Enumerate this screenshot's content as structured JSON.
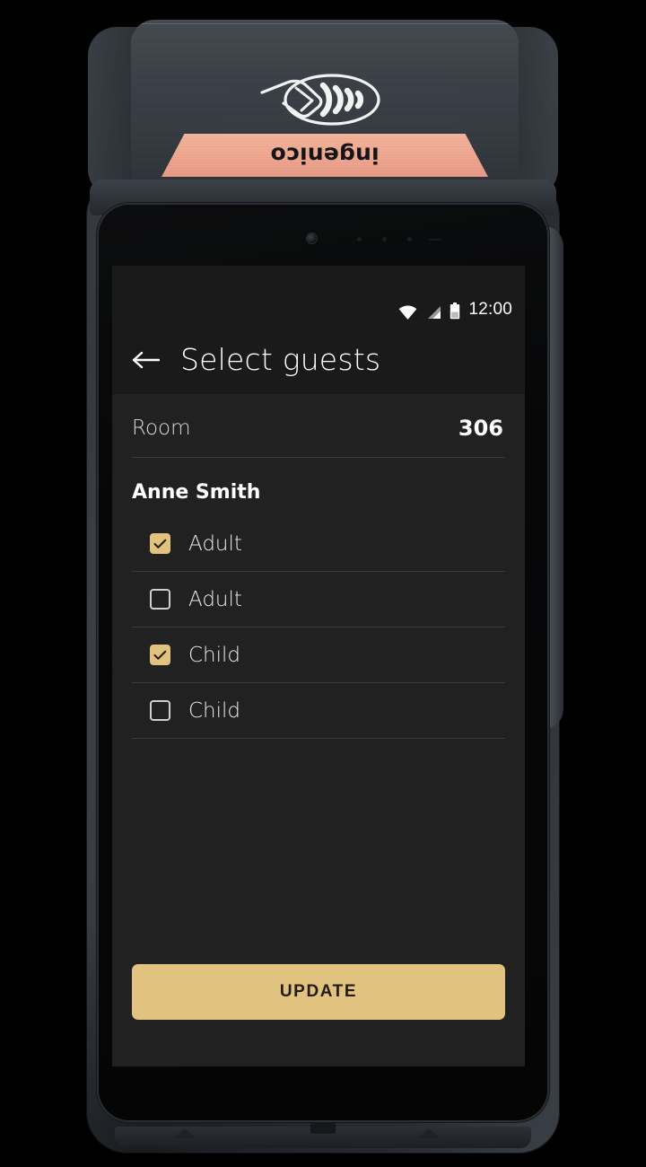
{
  "device": {
    "brand": "ingenico",
    "contactless_icon": "contactless-payment-icon"
  },
  "statusbar": {
    "wifi_icon": "wifi-icon",
    "signal_icon": "cellular-signal-icon",
    "battery_icon": "battery-icon",
    "time": "12:00"
  },
  "toolbar": {
    "back_icon": "arrow-left-icon",
    "title": "Select guests"
  },
  "room": {
    "label": "Room",
    "value": "306"
  },
  "guest": {
    "name": "Anne Smith"
  },
  "guests": [
    {
      "label": "Adult",
      "checked": true
    },
    {
      "label": "Adult",
      "checked": false
    },
    {
      "label": "Child",
      "checked": true
    },
    {
      "label": "Child",
      "checked": false
    }
  ],
  "footer": {
    "update_label": "UPDATE"
  },
  "colors": {
    "accent": "#e2c27f",
    "screen_bg": "#212121",
    "toolbar_bg": "#1a1a1a",
    "divider": "#3a3a3a",
    "brand_strip": "#efa791"
  }
}
